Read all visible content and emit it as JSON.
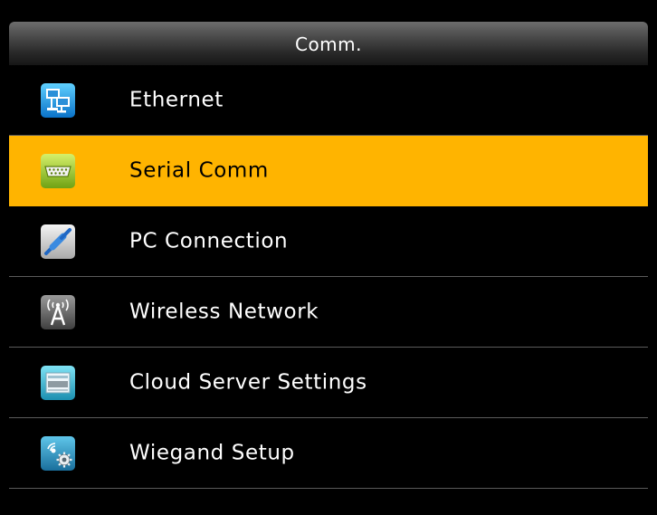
{
  "header": {
    "title": "Comm."
  },
  "menu": {
    "items": [
      {
        "label": "Ethernet",
        "icon": "ethernet-icon",
        "selected": false
      },
      {
        "label": "Serial Comm",
        "icon": "serial-port-icon",
        "selected": true
      },
      {
        "label": "PC Connection",
        "icon": "pc-connection-icon",
        "selected": false
      },
      {
        "label": "Wireless Network",
        "icon": "wireless-network-icon",
        "selected": false
      },
      {
        "label": "Cloud Server Settings",
        "icon": "cloud-server-icon",
        "selected": false
      },
      {
        "label": "Wiegand Setup",
        "icon": "wiegand-setup-icon",
        "selected": false
      }
    ]
  },
  "colors": {
    "selected_background": "#ffb400",
    "background": "#000000",
    "text": "#ffffff",
    "divider": "#5a5a5a"
  }
}
